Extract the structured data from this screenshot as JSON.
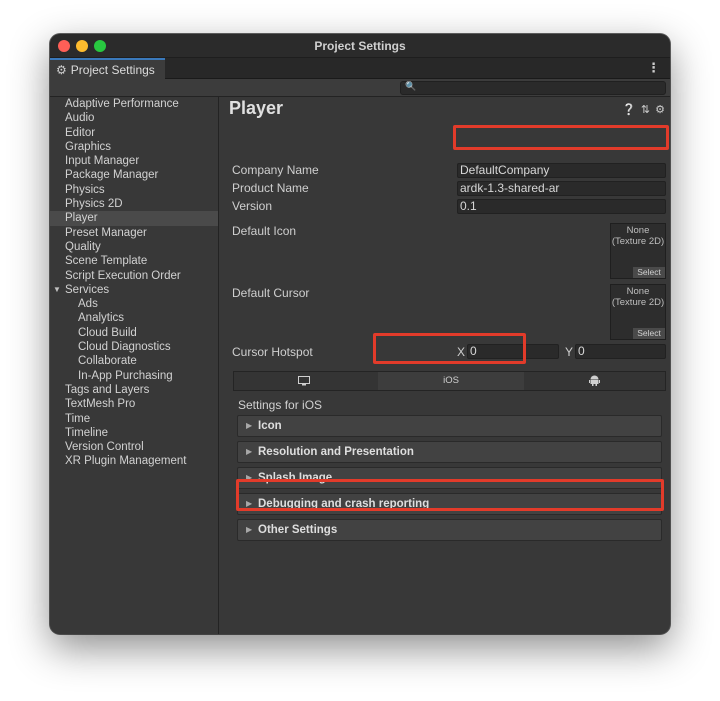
{
  "window": {
    "title": "Project Settings"
  },
  "tab": {
    "label": "Project Settings",
    "icon": "gear-icon",
    "menu_icon": "more-vertical-icon"
  },
  "search": {
    "icon": "search-icon",
    "value": ""
  },
  "sidebar": {
    "items": [
      {
        "label": "Adaptive Performance"
      },
      {
        "label": "Audio"
      },
      {
        "label": "Editor"
      },
      {
        "label": "Graphics"
      },
      {
        "label": "Input Manager"
      },
      {
        "label": "Package Manager"
      },
      {
        "label": "Physics"
      },
      {
        "label": "Physics 2D"
      },
      {
        "label": "Player",
        "selected": true
      },
      {
        "label": "Preset Manager"
      },
      {
        "label": "Quality"
      },
      {
        "label": "Scene Template"
      },
      {
        "label": "Script Execution Order"
      },
      {
        "label": "Services",
        "expanded": true
      },
      {
        "label": "Ads",
        "child": true
      },
      {
        "label": "Analytics",
        "child": true
      },
      {
        "label": "Cloud Build",
        "child": true
      },
      {
        "label": "Cloud Diagnostics",
        "child": true
      },
      {
        "label": "Collaborate",
        "child": true
      },
      {
        "label": "In-App Purchasing",
        "child": true
      },
      {
        "label": "Tags and Layers"
      },
      {
        "label": "TextMesh Pro"
      },
      {
        "label": "Time"
      },
      {
        "label": "Timeline"
      },
      {
        "label": "Version Control"
      },
      {
        "label": "XR Plugin Management"
      }
    ]
  },
  "player": {
    "title": "Player",
    "header_icons": [
      "help-icon",
      "presets-icon",
      "settings-icon"
    ],
    "company_name_label": "Company Name",
    "company_name": "DefaultCompany",
    "product_name_label": "Product Name",
    "product_name": "ardk-1.3-shared-ar",
    "version_label": "Version",
    "version": "0.1",
    "default_icon_label": "Default Icon",
    "default_cursor_label": "Default Cursor",
    "texture_none": "None",
    "texture_type": "(Texture 2D)",
    "select_label": "Select",
    "cursor_hotspot_label": "Cursor Hotspot",
    "hotspot_x_label": "X",
    "hotspot_x": "0",
    "hotspot_y_label": "Y",
    "hotspot_y": "0"
  },
  "platforms": {
    "tabs": [
      {
        "name": "desktop",
        "icon": "monitor-icon"
      },
      {
        "name": "ios",
        "label": "iOS",
        "selected": true
      },
      {
        "name": "android",
        "icon": "android-icon"
      }
    ]
  },
  "settings": {
    "heading": "Settings for iOS",
    "sections": [
      {
        "label": "Icon"
      },
      {
        "label": "Resolution and Presentation"
      },
      {
        "label": "Splash Image"
      },
      {
        "label": "Debugging and crash reporting"
      },
      {
        "label": "Other Settings"
      }
    ]
  },
  "colors": {
    "highlight": "#e23b2a",
    "accent": "#3a79bb"
  }
}
